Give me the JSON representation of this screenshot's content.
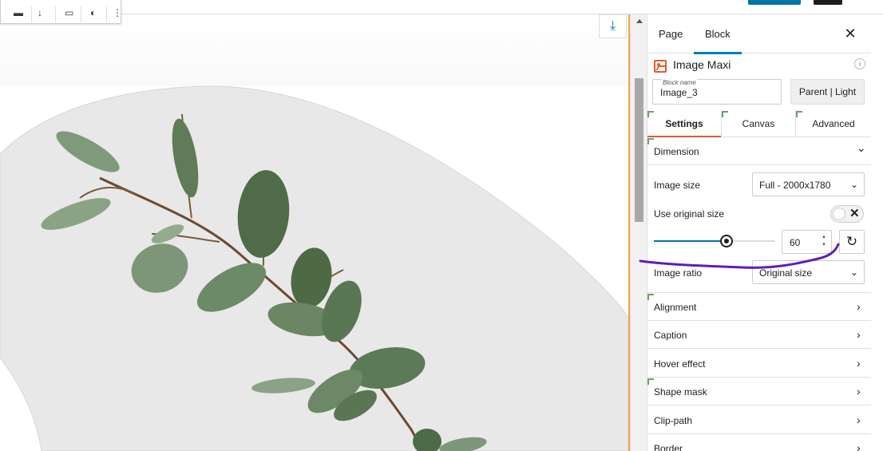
{
  "toolbar_tools": [
    "▬",
    "↓",
    "▭",
    "◐",
    "⋮"
  ],
  "canvas": {
    "insert_icon": "insert-into-icon",
    "insert_glyph": "⤓"
  },
  "sidebar": {
    "tabs": [
      {
        "label": "Page",
        "active": false
      },
      {
        "label": "Block",
        "active": true
      }
    ],
    "close_glyph": "✕",
    "block": {
      "title": "Image Maxi",
      "info_glyph": "i",
      "name_label": "Block name",
      "name_value": "Image_3",
      "parent_button": "Parent | Light"
    },
    "settings_tabs": [
      {
        "label": "Settings",
        "active": true
      },
      {
        "label": "Canvas",
        "active": false
      },
      {
        "label": "Advanced",
        "active": false
      }
    ],
    "dimension": {
      "heading": "Dimension",
      "image_size_label": "Image size",
      "image_size_value": "Full - 2000x1780",
      "use_original_label": "Use original size",
      "toggle_x": "✕",
      "slider_value_percent": 60,
      "number_value": "60",
      "reset_glyph": "↻",
      "image_ratio_label": "Image ratio",
      "image_ratio_value": "Original size"
    },
    "sections": [
      "Alignment",
      "Caption",
      "Hover effect",
      "Shape mask",
      "Clip-path",
      "Border"
    ],
    "section_marked": [
      true,
      false,
      false,
      true,
      false,
      false
    ],
    "chevron_right": "›",
    "chevron_down": "⌄",
    "caret": "⌄"
  },
  "colors": {
    "accent_blue": "#007cba",
    "accent_orange": "#e25b2d",
    "marker_green": "#6e9e6a",
    "annotation_purple": "#5b1fb5"
  }
}
